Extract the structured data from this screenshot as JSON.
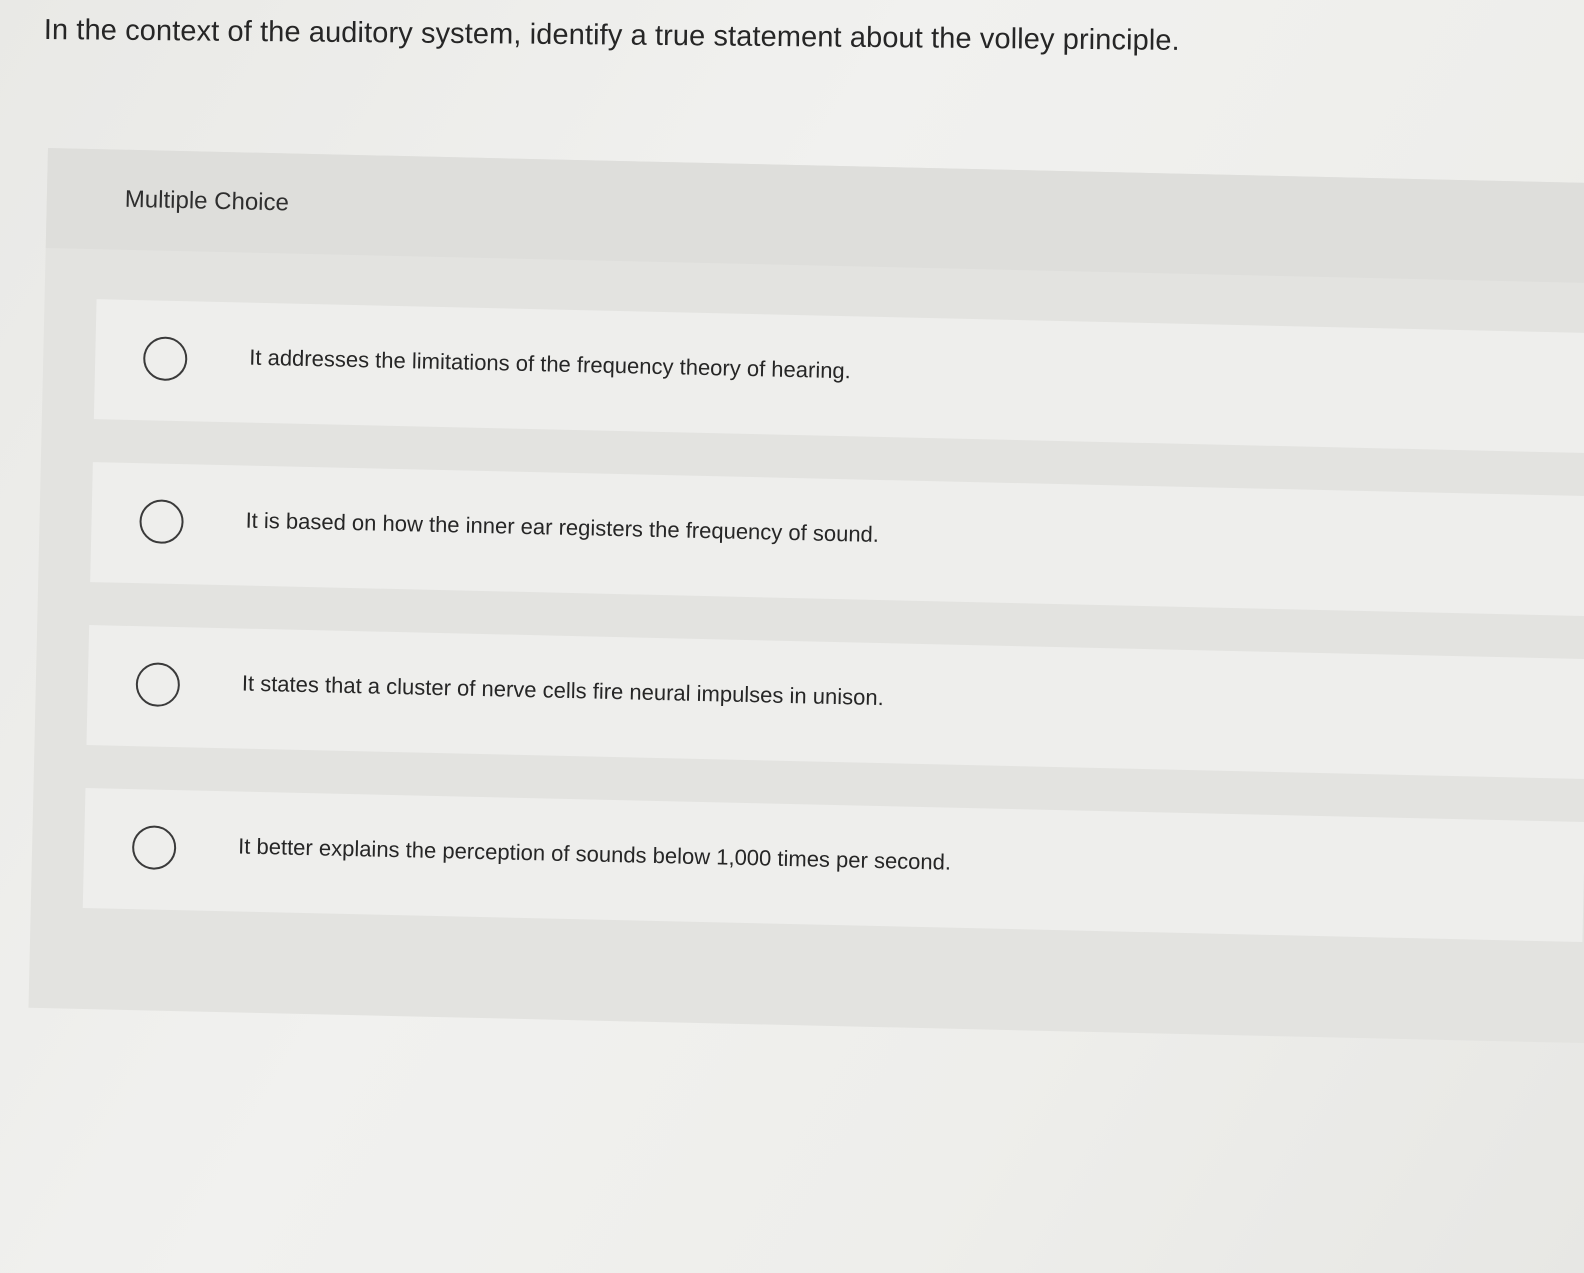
{
  "question": {
    "text": "In the context of the auditory system, identify a true statement about the volley principle."
  },
  "multiple_choice": {
    "label": "Multiple Choice",
    "options": [
      {
        "text": "It addresses the limitations of the frequency theory of hearing.",
        "selected": false
      },
      {
        "text": "It is based on how the inner ear registers the frequency of sound.",
        "selected": false
      },
      {
        "text": "It states that a cluster of nerve cells fire neural impulses in unison.",
        "selected": false
      },
      {
        "text": "It better explains the perception of sounds below 1,000 times per second.",
        "selected": false
      }
    ]
  }
}
